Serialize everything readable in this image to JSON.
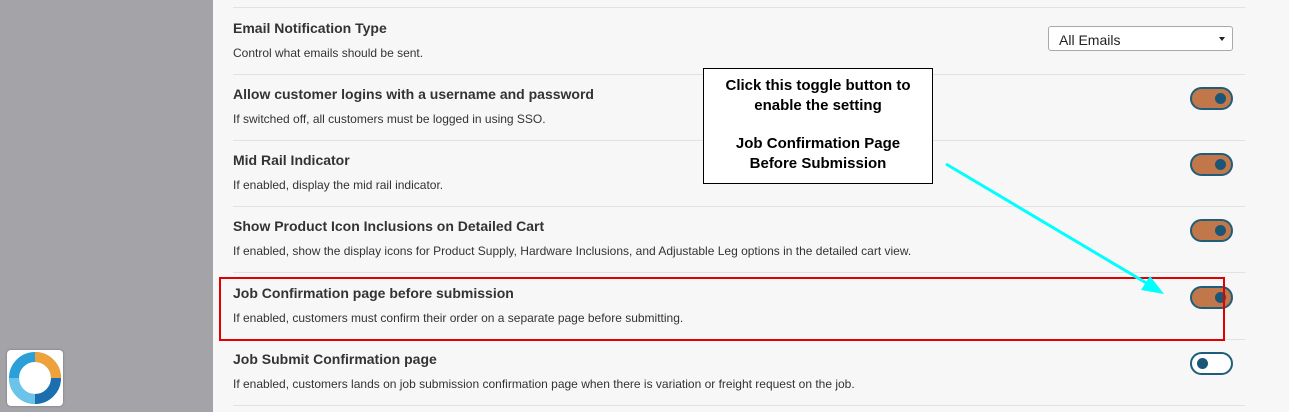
{
  "settings": {
    "email": {
      "title": "Email Notification Type",
      "description": "Control what emails should be sent.",
      "selected": "All Emails"
    },
    "rows": [
      {
        "title": "Allow customer logins with a username and password",
        "description": "If switched off, all customers must be logged in using SSO.",
        "enabled": true
      },
      {
        "title": "Mid Rail Indicator",
        "description": "If enabled, display the mid rail indicator.",
        "enabled": true
      },
      {
        "title": "Show Product Icon Inclusions on Detailed Cart",
        "description": "If enabled, show the display icons for Product Supply, Hardware Inclusions, and Adjustable Leg options in the detailed cart view.",
        "enabled": true
      },
      {
        "title": "Job Confirmation page before submission",
        "description": "If enabled, customers must confirm their order on a separate page before submitting.",
        "enabled": true
      },
      {
        "title": "Job Submit Confirmation page",
        "description": "If enabled, customers lands on job submission confirmation page when there is variation or freight request on the job.",
        "enabled": false
      }
    ]
  },
  "callout": {
    "line1": "Click this toggle button to",
    "line2": "enable the setting",
    "line3": "Job Confirmation Page",
    "line4": "Before Submission"
  },
  "colors": {
    "toggle_on": "#c2774a",
    "toggle_border": "#1f5d79",
    "highlight": "#e00000",
    "arrow": "#00ffff"
  },
  "icons": {
    "app_logo": "app-logo-icon",
    "select_caret": "caret-down-icon"
  }
}
